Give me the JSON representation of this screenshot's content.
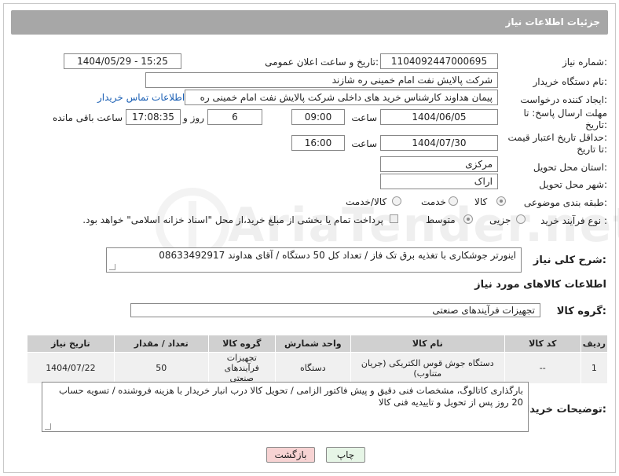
{
  "header": {
    "title": "جزئیات اطلاعات نیاز"
  },
  "form": {
    "need_number_label": "شماره نیاز:",
    "need_number": "1104092447000695",
    "announce_label": "تاریخ و ساعت اعلان عمومی:",
    "announce_value": "1404/05/29 - 15:25",
    "buyer_label": "نام دستگاه خریدار:",
    "buyer_value": "شرکت پالایش نفت امام خمینی  ره  شازند",
    "creator_label": "ایجاد کننده درخواست:",
    "creator_value": "پیمان هداوند کارشناس خرید های داخلی  شرکت پالایش نفت امام خمینی  ره",
    "contact_link": "اطلاعات تماس خریدار",
    "deadline_label_1": "مهلت ارسال پاسخ: تا",
    "deadline_label_2": "تاریخ:",
    "deadline_date": "1404/06/05",
    "time_label": "ساعت",
    "deadline_time": "09:00",
    "days_value": "6",
    "days_label": "روز و",
    "remaining_time": "17:08:35",
    "remaining_label": "ساعت باقی مانده",
    "min_price_label_1": "حداقل تاریخ اعتبار قیمت:",
    "min_price_label_2": "تا تاریخ:",
    "price_date": "1404/07/30",
    "price_time": "16:00",
    "province_label": "استان محل تحویل:",
    "province_value": "مرکزی",
    "city_label": "شهر محل تحویل:",
    "city_value": "اراک",
    "category_label": "طبقه بندی موضوعی:",
    "category_options": [
      "کالا",
      "خدمت",
      "کالا/خدمت"
    ],
    "process_label": "نوع فرآیند خرید :",
    "process_options": [
      "جزیی",
      "متوسط"
    ],
    "payment_note": "پرداخت تمام یا بخشی از مبلغ خرید،از محل \"اسناد خزانه اسلامی\" خواهد بود.",
    "description_label": "شرح کلی نیاز:",
    "description_value": "اینورتر جوشکاری  با تغذیه برق تک فاز / تعداد کل 50 دستگاه / آقای هداوند  08633492917"
  },
  "goods": {
    "section_title": "اطلاعات کالاهای مورد نیاز",
    "group_label": "گروه کالا:",
    "group_value": "تجهیزات فرآیندهای صنعتی",
    "columns": [
      "ردیف",
      "کد کالا",
      "نام کالا",
      "واحد شمارش",
      "گروه کالا",
      "تعداد / مقدار",
      "تاریخ نیاز"
    ],
    "rows": [
      {
        "row": "1",
        "code": "--",
        "name": "دستگاه جوش قوس الکتریکی (جریان متناوب)",
        "unit": "دستگاه",
        "group": "تجهیزات فرآیندهای صنعتی",
        "qty": "50",
        "date": "1404/07/22"
      }
    ]
  },
  "buyer_notes": {
    "label": "توضیحات خریدار:",
    "value": "بارگذاری کاتالوگ، مشخصات فنی دقیق و پیش فاکتور الزامی / تحویل کالا درب انبار خریدار با هزینه فروشنده / تسویه حساب 20 روز پس از تحویل و تاییدیه فنی کالا"
  },
  "buttons": {
    "print": "چاپ",
    "back": "بازگشت"
  },
  "colors": {
    "header_bg": "#a7a7a7",
    "link": "#1a5fb4",
    "back_button": "#f7d3d3",
    "print_button": "#e6f5e6"
  }
}
